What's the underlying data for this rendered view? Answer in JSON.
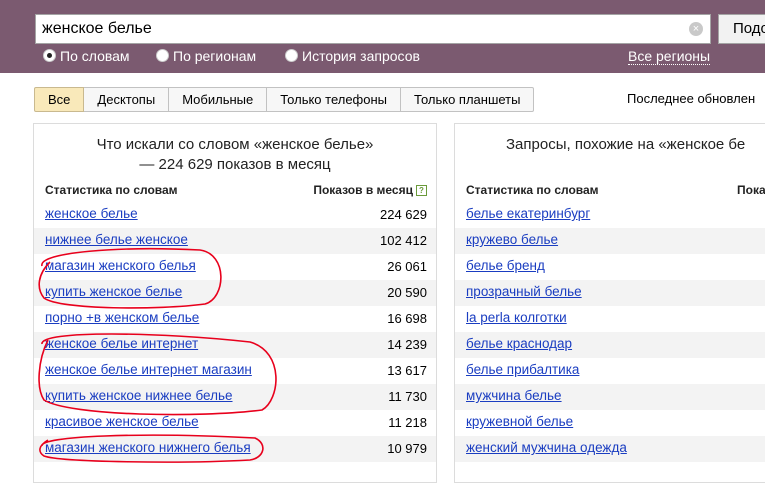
{
  "search": {
    "query": "женское белье",
    "clear_icon": "×",
    "submit_label": "Подо"
  },
  "modes": [
    {
      "label": "По словам",
      "checked": true
    },
    {
      "label": "По регионам",
      "checked": false
    },
    {
      "label": "История запросов",
      "checked": false
    }
  ],
  "all_regions": "Все регионы",
  "device_tabs": [
    "Все",
    "Десктопы",
    "Мобильные",
    "Только телефоны",
    "Только планшеты"
  ],
  "active_tab": "Все",
  "last_update": "Последнее обновлен",
  "left_panel": {
    "title": "Что искали со словом «женское белье» — 224 629 показов в месяц",
    "col_words": "Статистика по словам",
    "col_shows": "Показов в месяц",
    "help_icon": "?",
    "rows": [
      {
        "phrase": "женское белье",
        "count": "224 629"
      },
      {
        "phrase": "нижнее белье женское",
        "count": "102 412"
      },
      {
        "phrase": "магазин женского белья",
        "count": "26 061"
      },
      {
        "phrase": "купить женское белье",
        "count": "20 590"
      },
      {
        "phrase": "порно +в женском белье",
        "count": "16 698"
      },
      {
        "phrase": "женское белье интернет",
        "count": "14 239"
      },
      {
        "phrase": "женское белье интернет магазин",
        "count": "13 617"
      },
      {
        "phrase": "купить женское нижнее белье",
        "count": "11 730"
      },
      {
        "phrase": "красивое женское белье",
        "count": "11 218"
      },
      {
        "phrase": "магазин женского нижнего белья",
        "count": "10 979"
      }
    ]
  },
  "right_panel": {
    "title": "Запросы, похожие на «женское бе",
    "col_words": "Статистика по словам",
    "col_shows": "Показ",
    "rows": [
      {
        "phrase": "белье екатеринбург"
      },
      {
        "phrase": "кружево белье"
      },
      {
        "phrase": "белье бренд"
      },
      {
        "phrase": "прозрачный белье"
      },
      {
        "phrase": "la perla колготки"
      },
      {
        "phrase": "белье краснодар"
      },
      {
        "phrase": "белье прибалтика"
      },
      {
        "phrase": "мужчина белье"
      },
      {
        "phrase": "кружевной белье"
      },
      {
        "phrase": "женский мужчина одежда"
      }
    ]
  },
  "colors": {
    "header_bg": "#7b5a70",
    "link": "#1a3dc1",
    "active_tab": "#f9e9ba",
    "annotation": "#e8001c"
  }
}
